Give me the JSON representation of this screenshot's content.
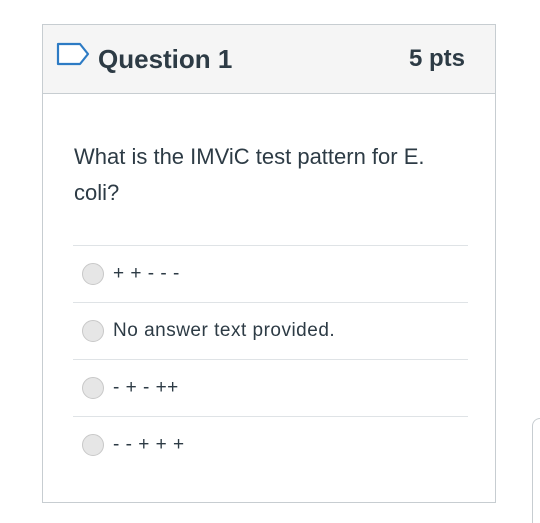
{
  "question": {
    "title": "Question 1",
    "points": "5 pts",
    "text": "What is the IMViC  test pattern for E. coli?",
    "flag_icon": "flag-outline-icon"
  },
  "answers": [
    {
      "label": "+ + - - -",
      "selected": false
    },
    {
      "label": "No answer text provided.",
      "selected": false
    },
    {
      "label": "- + - ++",
      "selected": false
    },
    {
      "label": "- - + + +",
      "selected": false
    }
  ],
  "colors": {
    "text": "#2d3b45",
    "header_bg": "#f5f5f5",
    "border": "#c7cdd1",
    "flag": "#2d7bc4",
    "radio_fill": "#e6e6e6"
  }
}
